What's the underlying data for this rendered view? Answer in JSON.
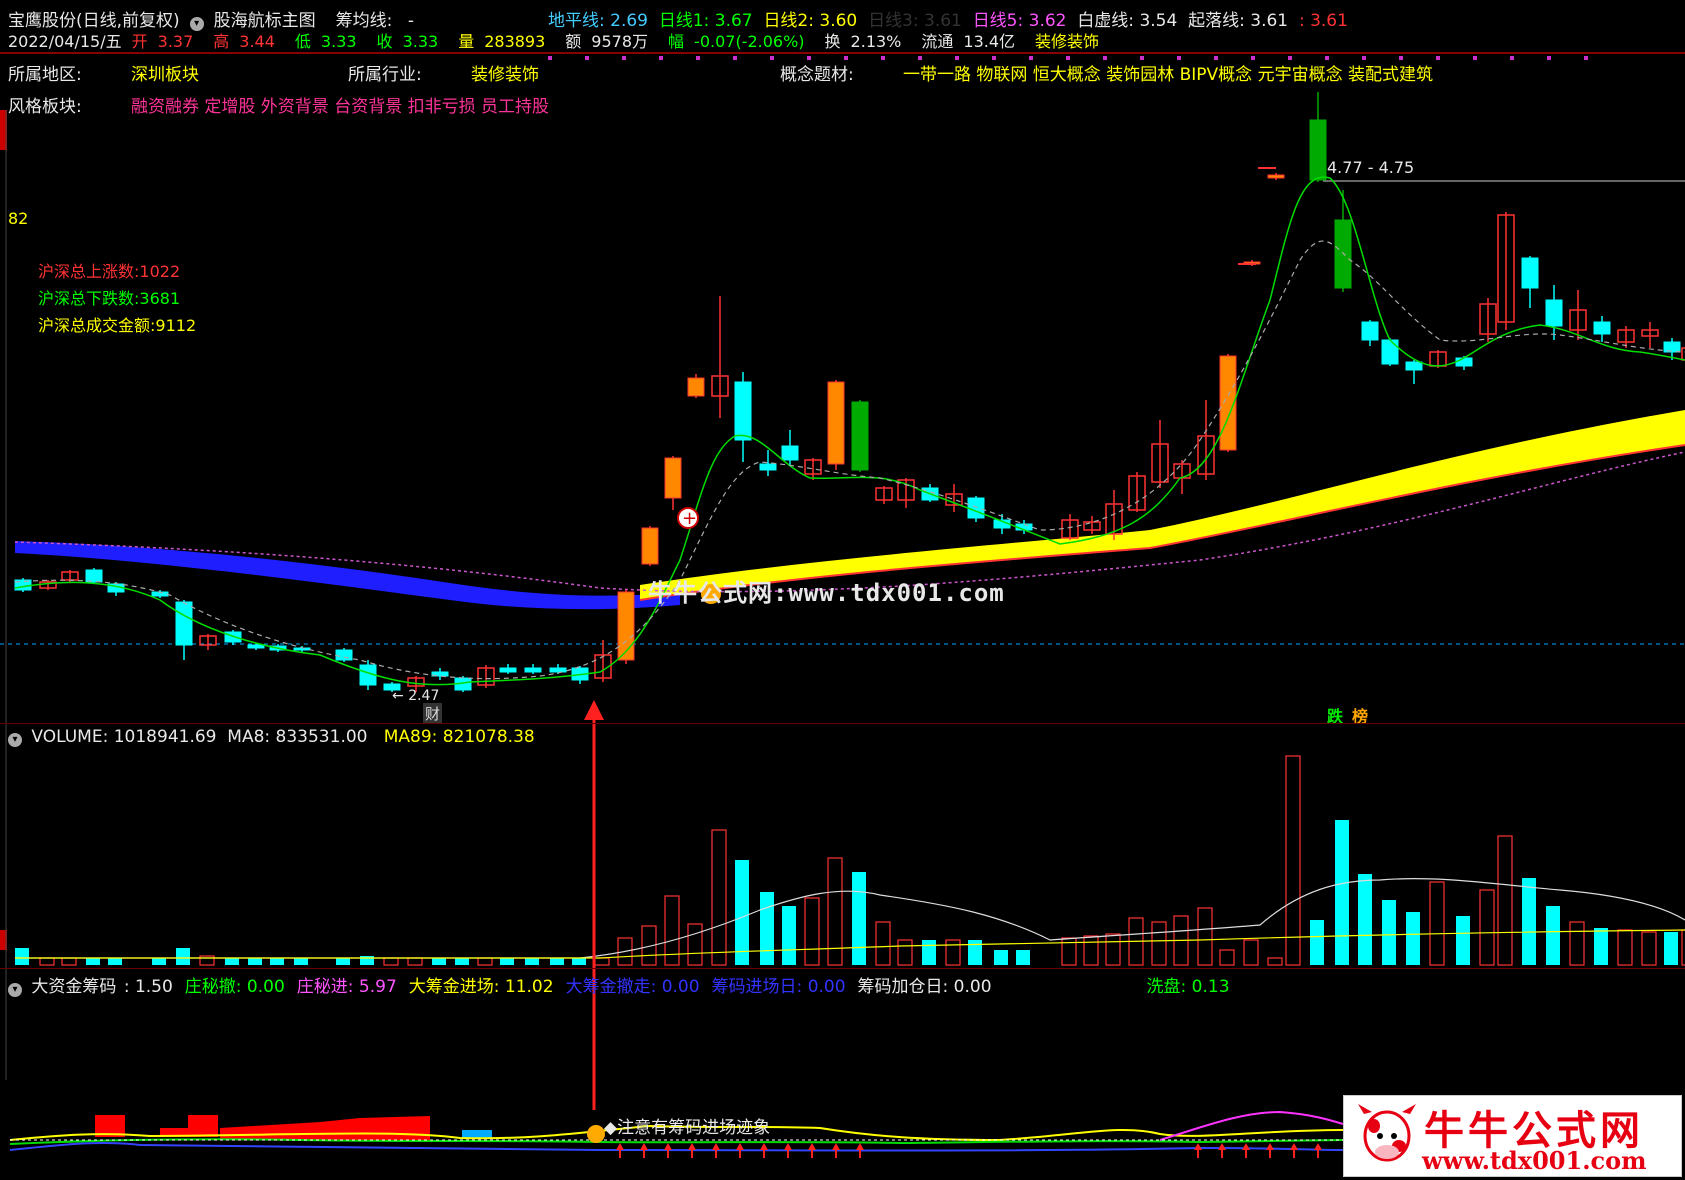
{
  "header": {
    "title": "宝鹰股份(日线,前复权)",
    "indicator": "股海航标主图",
    "chip_label": "筹均线:",
    "chip_value": "-",
    "lines": [
      {
        "label": "地平线:",
        "value": "2.69"
      },
      {
        "label": "日线1:",
        "value": "3.67"
      },
      {
        "label": "日线2:",
        "value": "3.60"
      },
      {
        "label": "日线3:",
        "value": "3.61"
      },
      {
        "label": "日线5:",
        "value": "3.62"
      },
      {
        "label": "白虚线:",
        "value": "3.54"
      },
      {
        "label": "起落线:",
        "value": "3.61"
      },
      {
        "label": "",
        "value": ": 3.61"
      }
    ]
  },
  "quote": {
    "date": "2022/04/15/五",
    "open_label": "开",
    "open": "3.37",
    "high_label": "高",
    "high": "3.44",
    "low_label": "低",
    "low": "3.33",
    "close_label": "收",
    "close": "3.33",
    "vol_label": "量",
    "vol": "283893",
    "amount_label": "额",
    "amount": "9578万",
    "change_label": "幅",
    "change": "-0.07(-2.06%)",
    "turnover_label": "换",
    "turnover": "2.13%",
    "float_label": "流通",
    "float": "13.4亿",
    "sector": "装修装饰"
  },
  "info": {
    "region_label": "所属地区:",
    "region": "深圳板块",
    "industry_label": "所属行业:",
    "industry": "装修装饰",
    "concept_label": "概念题材:",
    "concept": "一带一路 物联网 恒大概念 装饰园林 BIPV概念 元宇宙概念 装配式建筑",
    "style_label": "风格板块:",
    "style": "融资融券 定增股 外资背景 台资背景 扣非亏损 员工持股"
  },
  "market": {
    "price_axis": "82",
    "up_label": "沪深总上涨数:",
    "up": "1022",
    "down_label": "沪深总下跌数:",
    "down": "3681",
    "amount_label": "沪深总成交金额:",
    "amount": "9112"
  },
  "annotations": {
    "high_range": "4.77 - 4.75",
    "low_price": "2.47",
    "cai": "财",
    "die": "跌",
    "bang": "榜",
    "watermark": "牛牛公式网:www.tdx001.com",
    "chip_note": "注意有筹码进场迹象"
  },
  "volume": {
    "label": "VOLUME:",
    "value": "1018941.69",
    "ma8_label": "MA8:",
    "ma8": "833531.00",
    "ma89_label": "MA89:",
    "ma89": "821078.38"
  },
  "funds": {
    "title": "大资金筹码",
    "items": [
      {
        "label": ":",
        "value": "1.50",
        "color": "#e8e8e8"
      },
      {
        "label": "庄秘撤:",
        "value": "0.00",
        "color": "#00ff00"
      },
      {
        "label": "庄秘进:",
        "value": "5.97",
        "color": "#ff55ff"
      },
      {
        "label": "大筹金进场:",
        "value": "11.02",
        "color": "#ffff00"
      },
      {
        "label": "大筹金撤走:",
        "value": "0.00",
        "color": "#3333ff"
      },
      {
        "label": "筹码进场日:",
        "value": "0.00",
        "color": "#3333ff"
      },
      {
        "label": "筹码加仓日:",
        "value": "0.00",
        "color": "#e8e8e8"
      },
      {
        "label": "洗盘:",
        "value": "0.13",
        "color": "#00ff00"
      }
    ]
  },
  "logo": {
    "title": "牛牛公式网",
    "url": "www.tdx001.com"
  },
  "colors": {
    "up": "#ff3333",
    "down": "#00ffff",
    "bull": "#ff8800",
    "bear": "#00aa00",
    "ribbon_blue": "#1e1eff",
    "ribbon_yellow": "#ffff00"
  }
}
